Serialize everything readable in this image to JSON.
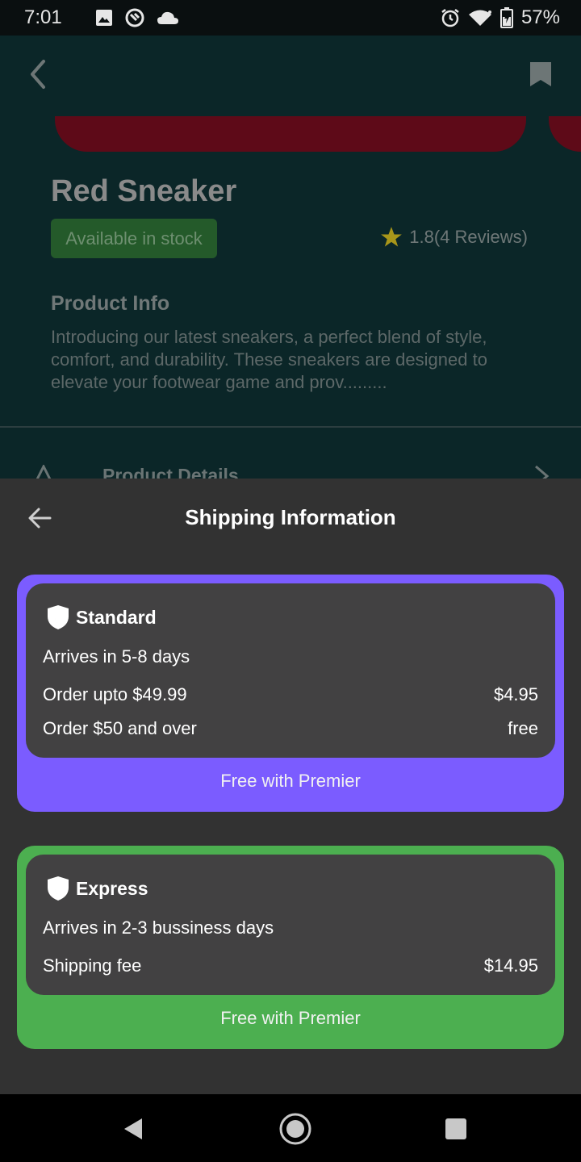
{
  "status_bar": {
    "time": "7:01",
    "battery": "57%",
    "icons_left": [
      "image-icon",
      "sync-icon",
      "cloud-icon"
    ],
    "icons_right": [
      "alarm-icon",
      "wifi-icon",
      "battery-icon"
    ]
  },
  "product": {
    "title": "Red Sneaker",
    "stock": "Available in stock",
    "rating": "1.8(4 Reviews)",
    "info_title": "Product Info",
    "description": "Introducing our latest sneakers, a perfect blend of style, comfort, and durability. These sneakers are designed to elevate your footwear game and prov.........",
    "details_label": "Product Details"
  },
  "shipping": {
    "title": "Shipping Information",
    "standard": {
      "name": "Standard",
      "arrives": "Arrives in 5-8 days",
      "row1_label": "Order upto $49.99",
      "row1_value": "$4.95",
      "row2_label": "Order $50 and over",
      "row2_value": "free",
      "premier": "Free with Premier",
      "accent": "#7b5cff"
    },
    "express": {
      "name": "Express",
      "arrives": "Arrives in 2-3 bussiness days",
      "fee_label": "Shipping fee",
      "fee_value": "$14.95",
      "premier": "Free with Premier",
      "accent": "#4caf50"
    }
  },
  "colors": {
    "sheet_bg": "#323232",
    "card_inner": "#424142",
    "star": "#a8961a"
  }
}
